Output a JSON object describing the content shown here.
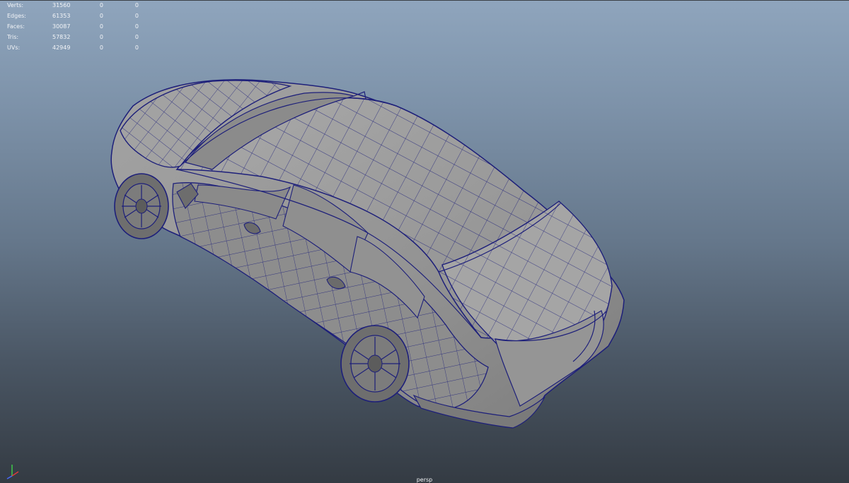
{
  "heads_up": {
    "rows": [
      {
        "label": "Verts:",
        "total": "31560",
        "selected": "0",
        "hidden": "0"
      },
      {
        "label": "Edges:",
        "total": "61353",
        "selected": "0",
        "hidden": "0"
      },
      {
        "label": "Faces:",
        "total": "30087",
        "selected": "0",
        "hidden": "0"
      },
      {
        "label": "Tris:",
        "total": "57832",
        "selected": "0",
        "hidden": "0"
      },
      {
        "label": "UVs:",
        "total": "42949",
        "selected": "0",
        "hidden": "0"
      }
    ]
  },
  "viewport": {
    "camera": "persp",
    "background_top": "#8fa5bd",
    "background_bottom": "#343b43",
    "wireframe_color": "#1d1f7a",
    "shaded_color": "#9a9a9a"
  },
  "axis_gizmo": {
    "x_color": "#e23b3b",
    "y_color": "#3fd14a",
    "z_color": "#4a6bff"
  }
}
